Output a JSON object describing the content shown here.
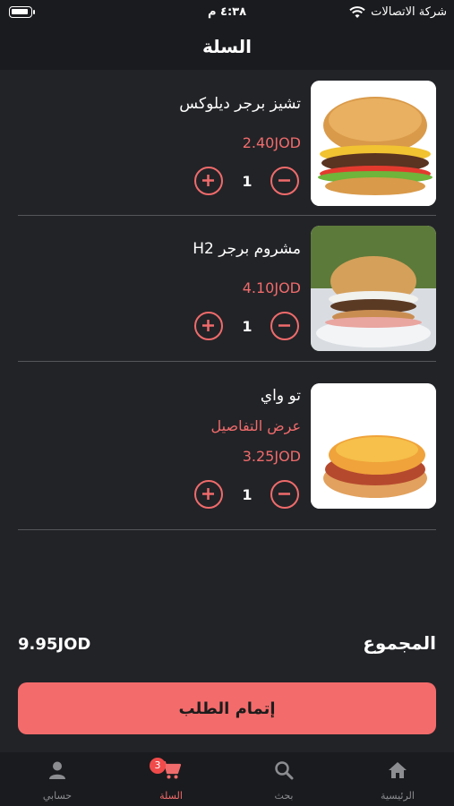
{
  "status_bar": {
    "time": "٤:٣٨ م",
    "carrier": "شركة الاتصالات"
  },
  "header": {
    "title": "السلة"
  },
  "cart": {
    "items": [
      {
        "name": "تشيز برجر ديلوكس",
        "price": "2.40JOD",
        "quantity": "1",
        "image": "cheeseburger"
      },
      {
        "name": "مشروم برجر H2",
        "price": "4.10JOD",
        "quantity": "1",
        "image": "mushroom-burger"
      },
      {
        "name": "تو واي",
        "details_link": "عرض التفاصيل",
        "price": "3.25JOD",
        "quantity": "1",
        "image": "hot-dog"
      }
    ]
  },
  "total": {
    "label": "المجموع",
    "value": "9.95JOD"
  },
  "checkout": {
    "label": "إتمام الطلب"
  },
  "bottom_nav": {
    "items": [
      {
        "label": "الرئيسية",
        "icon": "home-icon"
      },
      {
        "label": "بحث",
        "icon": "search-icon"
      },
      {
        "label": "السلة",
        "icon": "cart-icon",
        "badge": "3",
        "active": true
      },
      {
        "label": "حسابي",
        "icon": "account-icon"
      }
    ]
  },
  "colors": {
    "accent": "#f46b6b",
    "background": "#222327",
    "bar": "#1a1b1e"
  }
}
